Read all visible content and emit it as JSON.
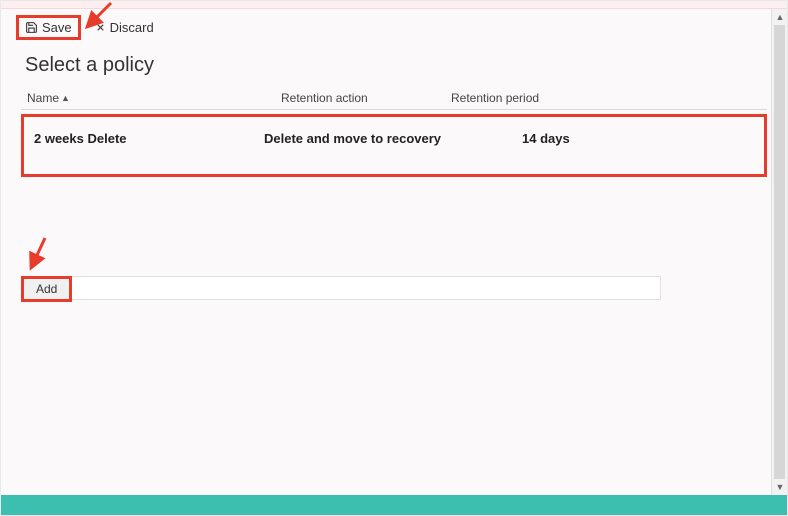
{
  "toolbar": {
    "save_label": "Save",
    "discard_label": "Discard"
  },
  "page": {
    "title": "Select a policy"
  },
  "columns": {
    "name": "Name",
    "action": "Retention action",
    "period": "Retention period"
  },
  "rows": [
    {
      "name": "2 weeks Delete",
      "action": "Delete and move to recovery",
      "period": "14 days"
    }
  ],
  "add": {
    "label": "Add"
  }
}
